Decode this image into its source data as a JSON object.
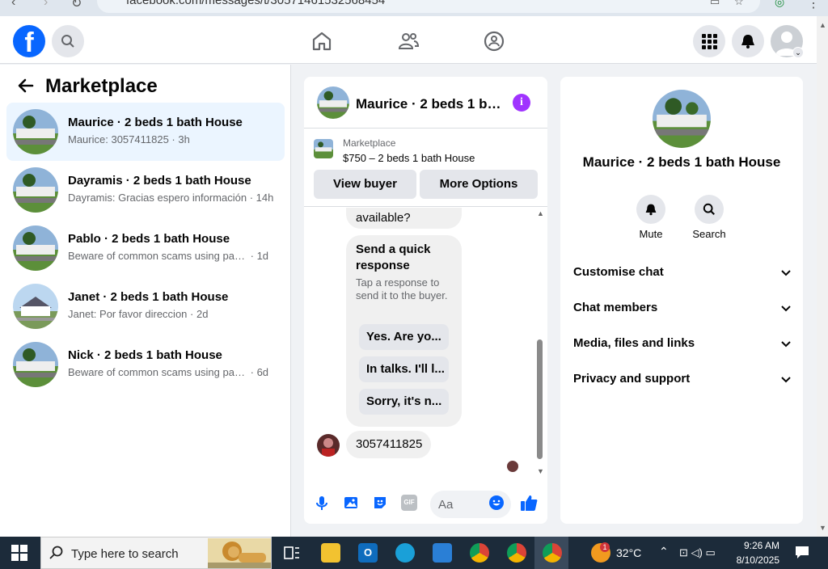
{
  "browser": {
    "url": "facebook.com/messages/t/30571461532568454"
  },
  "header": {
    "logo": "f"
  },
  "left": {
    "title": "Marketplace",
    "conversations": [
      {
        "title": "Maurice · 2 beds 1 bath House",
        "preview": "Maurice: 3057411825",
        "time": "3h"
      },
      {
        "title": "Dayramis · 2 beds 1 bath House",
        "preview": "Dayramis: Gracias espero información",
        "time": "14h"
      },
      {
        "title": "Pablo · 2 beds 1 bath House",
        "preview": "Beware of common scams using pay...",
        "time": "1d"
      },
      {
        "title": "Janet · 2 beds 1 bath House",
        "preview": "Janet: Por favor direccion",
        "time": "2d"
      },
      {
        "title": "Nick · 2 beds 1 bath House",
        "preview": "Beware of common scams using pay...",
        "time": "6d"
      }
    ]
  },
  "chat": {
    "title": "Maurice · 2 beds 1 ba...",
    "listing_source": "Marketplace",
    "listing_title": "$750 – 2 beds 1 bath House",
    "view_buyer": "View buyer",
    "more_options": "More Options",
    "msg_available": "available?",
    "quick_title": "Send a quick response",
    "quick_desc": "Tap a response to send it to the buyer.",
    "quick_replies": [
      "Yes. Are yo...",
      "In talks. I'll l...",
      "Sorry, it's n..."
    ],
    "last_message": "3057411825",
    "composer_placeholder": "Aa",
    "gif_label": "GIF"
  },
  "right": {
    "title": "Maurice · 2 beds 1 bath House",
    "mute": "Mute",
    "search": "Search",
    "sections": [
      "Customise chat",
      "Chat members",
      "Media, files and links",
      "Privacy and support"
    ]
  },
  "taskbar": {
    "search_placeholder": "Type here to search",
    "weather": "32°C",
    "weather_badge": "1",
    "time": "9:26 AM",
    "date": "8/10/2025"
  },
  "colors": {
    "brand": "#0866ff",
    "accent": "#a033ff",
    "active_row": "#ebf5ff"
  }
}
